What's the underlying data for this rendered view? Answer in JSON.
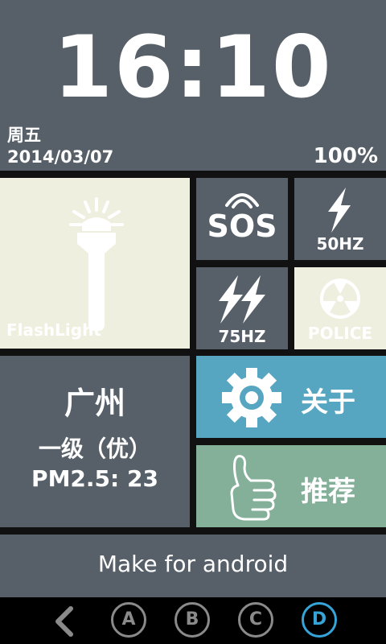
{
  "header": {
    "time": "16:10",
    "weekday": "周五",
    "date": "2014/03/07",
    "battery": "100%"
  },
  "tiles": {
    "flashlight": {
      "label": "FlashLight",
      "icon": "flashlight-icon"
    },
    "sos": {
      "label": "SOS",
      "icon": "sos-signal-icon"
    },
    "hz50": {
      "label": "50HZ",
      "icon": "lightning-icon"
    },
    "hz75": {
      "label": "75HZ",
      "icon": "double-lightning-icon"
    },
    "police": {
      "label": "POLICE",
      "icon": "radiation-icon"
    },
    "about": {
      "label": "关于",
      "icon": "gear-icon"
    },
    "recommend": {
      "label": "推荐",
      "icon": "thumbs-up-icon"
    }
  },
  "air": {
    "city": "广州",
    "level": "一级（优）",
    "pm": "PM2.5: 23"
  },
  "footer": {
    "text": "Make for android"
  },
  "nav": {
    "buttons": [
      "A",
      "B",
      "C",
      "D"
    ],
    "active": "D"
  },
  "colors": {
    "dark_tile": "#576069",
    "light_tile": "#eeefdf",
    "about_tile": "#56a6c1",
    "recommend_tile": "#84b09a",
    "nav_active": "#35a4d9"
  }
}
